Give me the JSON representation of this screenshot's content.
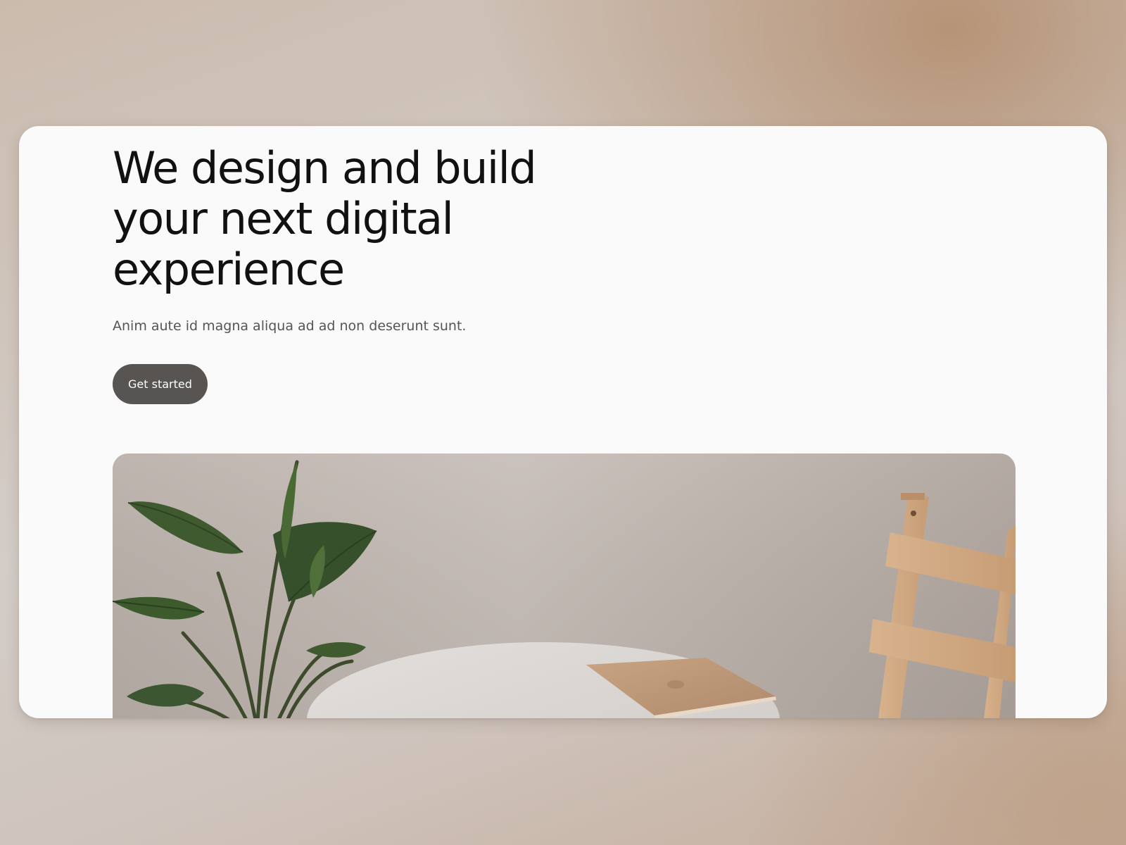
{
  "hero": {
    "title": "We design and build your next digital experience",
    "subtitle": "Anim aute id magna aliqua ad ad non deserunt sunt.",
    "cta_label": "Get started"
  },
  "colors": {
    "button_background": "#575452",
    "card_background": "#fafafa",
    "heading_text": "#111111",
    "body_text": "#555555"
  },
  "image": {
    "subject": "plant, round white table, laptop, wooden chair"
  }
}
